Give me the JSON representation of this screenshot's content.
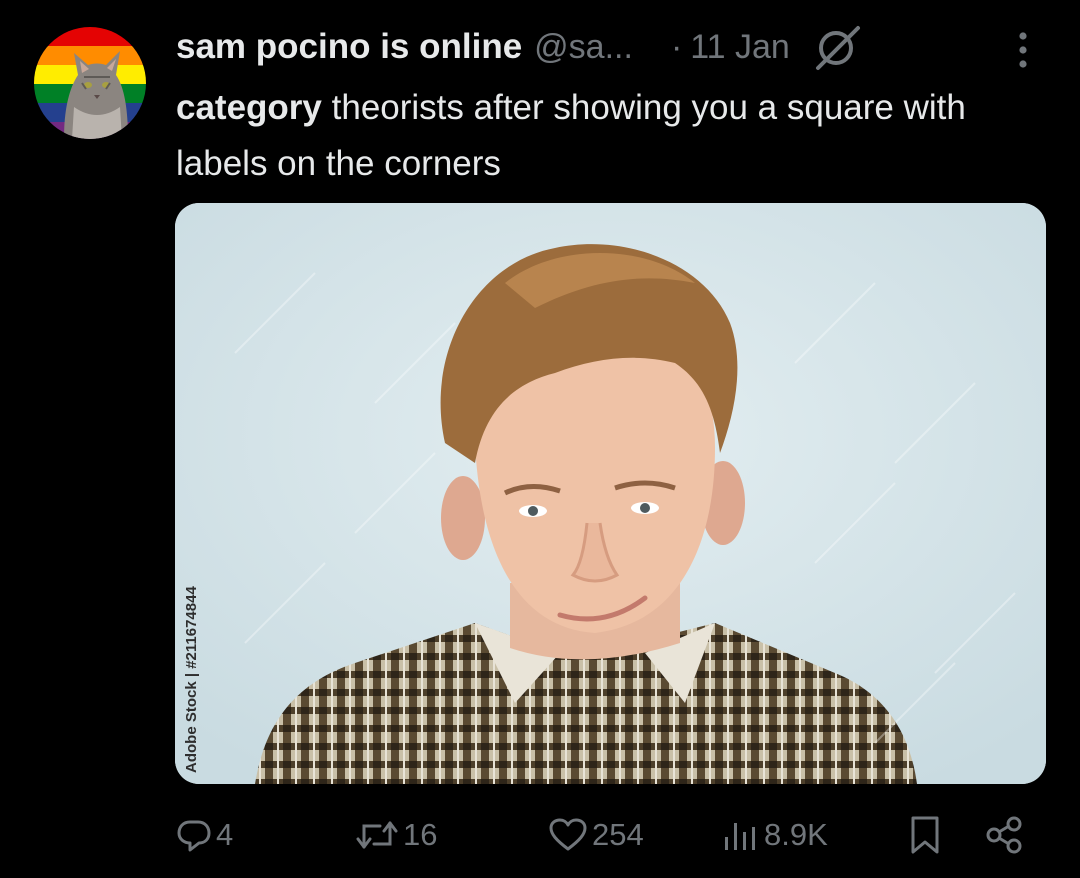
{
  "tweet": {
    "author_name": "sam pocino is online",
    "handle": "@sa...",
    "separator": "·",
    "date": "11 Jan",
    "text_bold": "category",
    "text_rest": " theorists after showing you a square with labels on the corners"
  },
  "media": {
    "overlay_text": "Adobe Stock | #211674844",
    "watermark": "Adobe Stock"
  },
  "actions": {
    "replies": "4",
    "reposts": "16",
    "likes": "254",
    "views": "8.9K"
  },
  "colors": {
    "background": "#000000",
    "primary_text": "#e7e9ea",
    "secondary_text": "#71767b"
  },
  "icons": {
    "grok": "grok-icon",
    "more": "more-icon",
    "reply": "reply-icon",
    "repost": "repost-icon",
    "like": "like-icon",
    "views": "views-icon",
    "bookmark": "bookmark-icon",
    "share": "share-icon"
  }
}
